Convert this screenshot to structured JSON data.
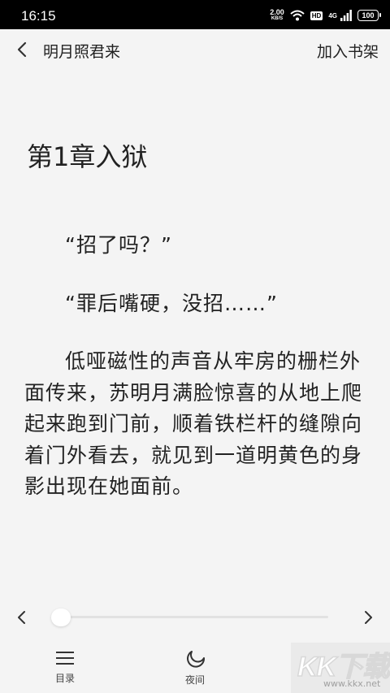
{
  "status_bar": {
    "time": "16:15",
    "net_speed_value": "2.00",
    "net_speed_unit": "KB/S",
    "hd_badge": "HD",
    "network_type": "4G",
    "battery": "100"
  },
  "header": {
    "book_title": "明月照君来",
    "add_to_shelf": "加入书架",
    "back_icon": "chevron-left-icon"
  },
  "chapter": {
    "title": "第1章入狱",
    "paragraphs": [
      "“招了吗？”",
      "“罪后嘴硬，没招……”",
      "低哑磁性的声音从牢房的栅栏外面传来，苏明月满脸惊喜的从地上爬起来跑到门前，顺着铁栏杆的缝隙向着门外看去，就见到一道明黄色的身影出现在她面前。"
    ]
  },
  "progress": {
    "value_fraction": 0.02,
    "prev_icon": "chevron-left-icon",
    "next_icon": "chevron-right-icon"
  },
  "bottom_bar": {
    "toc_label": "目录",
    "toc_icon": "menu-icon",
    "night_label": "夜间",
    "night_icon": "moon-icon"
  },
  "watermark": {
    "text": "KK下载",
    "url": "www.kkx.net"
  }
}
